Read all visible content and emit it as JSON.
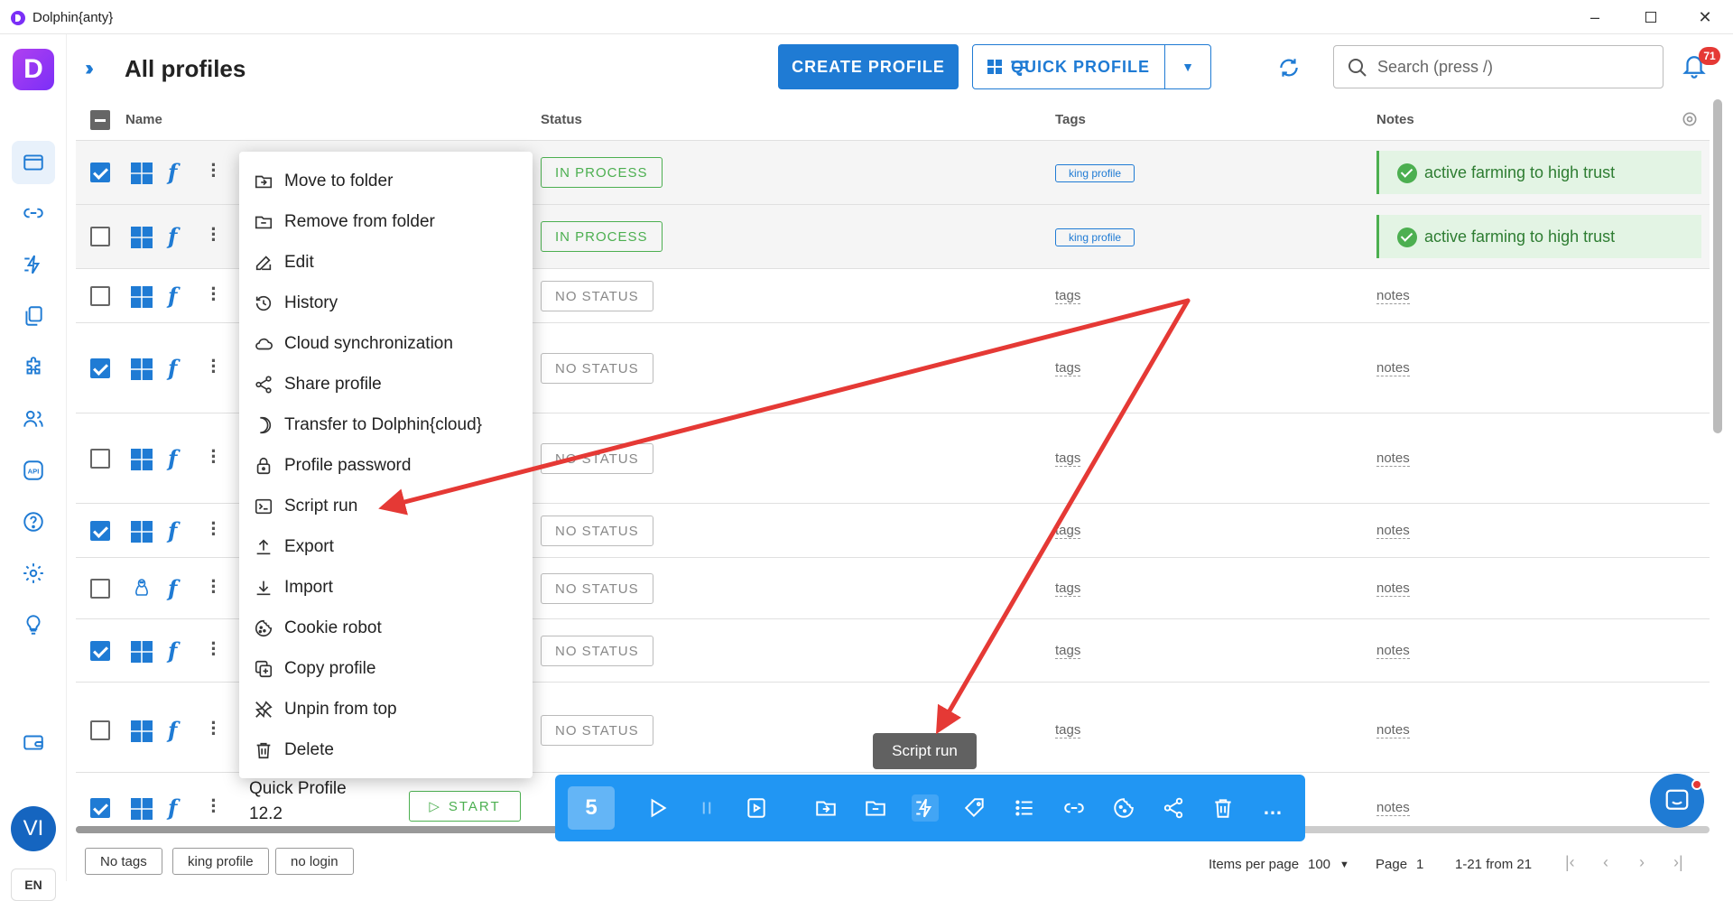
{
  "window": {
    "title": "Dolphin{anty}"
  },
  "sidebar": {
    "logo_letter": "D",
    "avatar": "VI",
    "language": "EN"
  },
  "header": {
    "title": "All profiles",
    "create_label": "CREATE PROFILE",
    "quick_label": "QUICK PROFILE",
    "search_placeholder": "Search (press /)",
    "notifications": "71"
  },
  "table": {
    "columns": {
      "name": "Name",
      "status": "Status",
      "tags": "Tags",
      "notes": "Notes"
    },
    "rows": [
      {
        "checked": true,
        "os": "windows",
        "status": "IN PROCESS",
        "tag": "king profile",
        "note": "active farming to high trust"
      },
      {
        "checked": false,
        "os": "windows",
        "status": "IN PROCESS",
        "tag": "king profile",
        "note": "active farming to high trust"
      },
      {
        "checked": false,
        "os": "windows",
        "status": "NO STATUS",
        "tag": "tags",
        "note": "notes"
      },
      {
        "checked": true,
        "os": "windows",
        "status": "NO STATUS",
        "tag": "tags",
        "note": "notes"
      },
      {
        "checked": false,
        "os": "windows",
        "status": "NO STATUS",
        "tag": "tags",
        "note": "notes"
      },
      {
        "checked": true,
        "os": "windows",
        "status": "NO STATUS",
        "tag": "tags",
        "note": "notes"
      },
      {
        "checked": false,
        "os": "linux",
        "status": "NO STATUS",
        "tag": "tags",
        "note": "notes"
      },
      {
        "checked": true,
        "os": "windows",
        "status": "NO STATUS",
        "tag": "tags",
        "note": "notes"
      },
      {
        "checked": false,
        "os": "windows",
        "status": "NO STATUS",
        "tag": "tags",
        "note": "notes"
      },
      {
        "checked": true,
        "os": "windows",
        "name": "Quick Profile 12.2",
        "start_label": "START",
        "tag": "",
        "note": "notes"
      }
    ]
  },
  "context_menu": {
    "items": [
      "Move to folder",
      "Remove from folder",
      "Edit",
      "History",
      "Cloud synchronization",
      "Share profile",
      "Transfer to Dolphin{cloud}",
      "Profile password",
      "Script run",
      "Export",
      "Import",
      "Cookie robot",
      "Copy profile",
      "Unpin from top",
      "Delete"
    ]
  },
  "action_bar": {
    "count": "5",
    "tooltip": "Script run"
  },
  "footer": {
    "chips": [
      "No tags",
      "king profile",
      "no login"
    ],
    "items_per_page_label": "Items per page",
    "items_per_page": "100",
    "page_label": "Page",
    "page": "1",
    "range": "1-21 from 21"
  },
  "colors": {
    "accent": "#1f7bd4",
    "success": "#4caf50",
    "annotation": "#e53935"
  }
}
